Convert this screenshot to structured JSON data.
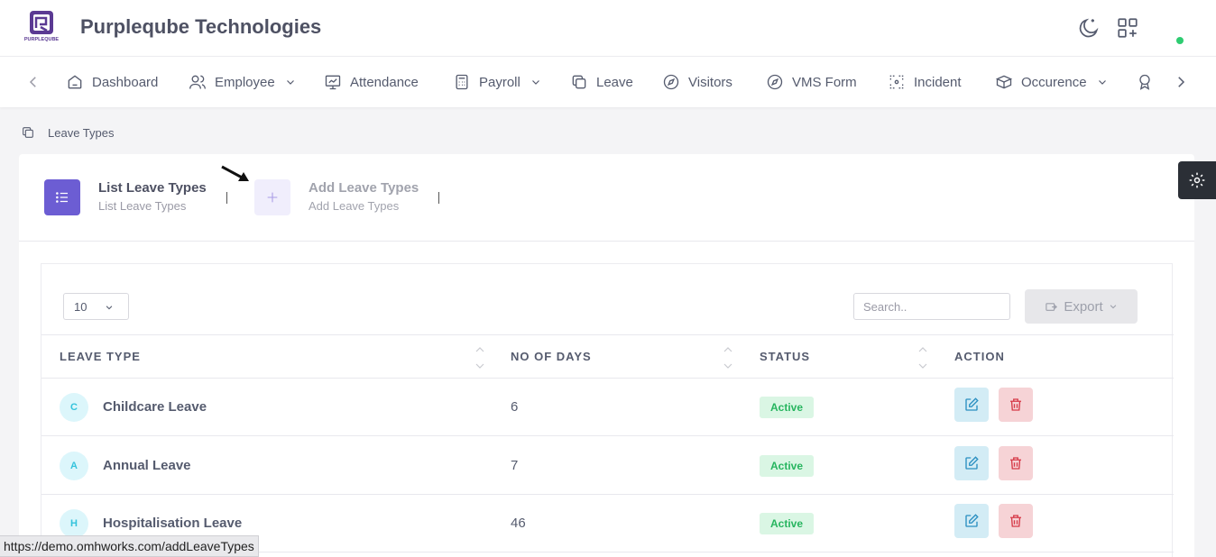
{
  "header": {
    "brand": "Purpleqube Technologies",
    "logo_text": "PURPLEQUBE",
    "icons": [
      "moon-icon",
      "apps-icon"
    ],
    "online_color": "#2ecc71"
  },
  "nav": {
    "items": [
      {
        "label": "Dashboard",
        "icon": "home-icon",
        "dropdown": false
      },
      {
        "label": "Employee",
        "icon": "users-icon",
        "dropdown": true
      },
      {
        "label": "Attendance",
        "icon": "monitor-chart-icon",
        "dropdown": false
      },
      {
        "label": "Payroll",
        "icon": "calculator-icon",
        "dropdown": true
      },
      {
        "label": "Leave",
        "icon": "copy-icon",
        "dropdown": false
      },
      {
        "label": "Visitors",
        "icon": "compass-icon",
        "dropdown": false
      },
      {
        "label": "VMS Form",
        "icon": "compass-icon",
        "dropdown": false
      },
      {
        "label": "Incident",
        "icon": "focus-icon",
        "dropdown": false
      },
      {
        "label": "Occurence",
        "icon": "boxes-icon",
        "dropdown": true
      }
    ]
  },
  "breadcrumb": {
    "label": "Leave Types"
  },
  "tabs": [
    {
      "title": "List Leave Types",
      "subtitle": "List Leave Types",
      "active": true
    },
    {
      "title": "Add Leave Types",
      "subtitle": "Add Leave Types",
      "active": false
    }
  ],
  "controls": {
    "page_length": "10",
    "search_placeholder": "Search..",
    "export_label": "Export"
  },
  "table": {
    "columns": [
      "LEAVE TYPE",
      "NO OF DAYS",
      "STATUS",
      "ACTION"
    ],
    "rows": [
      {
        "initial": "C",
        "name": "Childcare Leave",
        "days": "6",
        "status": "Active"
      },
      {
        "initial": "A",
        "name": "Annual Leave",
        "days": "7",
        "status": "Active"
      },
      {
        "initial": "H",
        "name": "Hospitalisation Leave",
        "days": "46",
        "status": "Active"
      }
    ]
  },
  "status_bar": {
    "url": "https://demo.omhworks.com/addLeaveTypes"
  },
  "colors": {
    "accent": "#6c5dd3",
    "accent_light": "#f0eefc",
    "active_green": "#27b55f",
    "edit_bg": "#d3ecf5",
    "delete_bg": "#f6d3d6"
  }
}
